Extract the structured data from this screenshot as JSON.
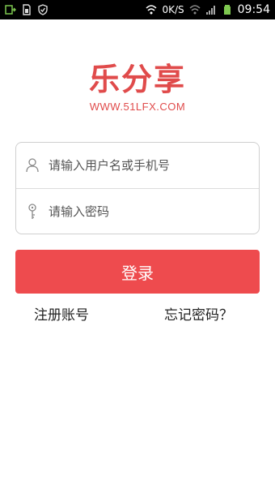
{
  "status_bar": {
    "speed": "0K/S",
    "time": "09:54"
  },
  "logo": {
    "title": "乐分享",
    "url": "WWW.51LFX.COM"
  },
  "login_form": {
    "username_placeholder": "请输入用户名或手机号",
    "password_placeholder": "请输入密码"
  },
  "login_button": "登录",
  "links": {
    "register": "注册账号",
    "forgot_password": "忘记密码？"
  },
  "colors": {
    "brand": "#e04b4b",
    "button": "#ee4b4e"
  }
}
